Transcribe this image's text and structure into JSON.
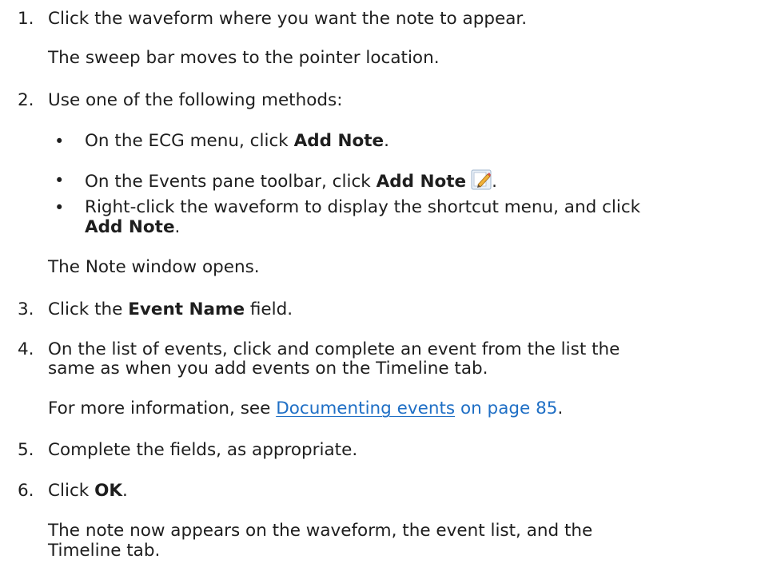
{
  "steps": [
    {
      "number": "1.",
      "text": "Click the waveform where you want the note to appear.",
      "result": "The sweep bar moves to the pointer location."
    },
    {
      "number": "2.",
      "text": "Use one of the following methods:",
      "bullets": [
        {
          "pre": "On the ECG menu, click ",
          "bold": "Add Note",
          "post": "."
        },
        {
          "pre": "On the Events pane toolbar, click ",
          "bold": "Add Note",
          "post": ".",
          "icon": "add-note-pencil-icon"
        },
        {
          "pre": "Right-click the waveform to display the shortcut menu, and click",
          "bold": "Add Note",
          "post": "."
        }
      ],
      "result": "The Note window opens."
    },
    {
      "number": "3.",
      "pre": "Click the ",
      "bold": "Event Name",
      "post": " field."
    },
    {
      "number": "4.",
      "line1": "On the list of events, click and complete an event from the list the",
      "line2": "same as when you add events on the Timeline tab.",
      "result_pre": "For more information, see ",
      "result_link": "Documenting events",
      "result_page": " on page 85",
      "result_post": "."
    },
    {
      "number": "5.",
      "text": "Complete the fields, as appropriate."
    },
    {
      "number": "6.",
      "pre": "Click ",
      "bold": "OK",
      "post": ".",
      "result_line1": "The note now appears on the waveform, the event list, and the",
      "result_line2": "Timeline tab."
    }
  ],
  "colors": {
    "text": "#1e1e1e",
    "link": "#1f6fc5"
  }
}
